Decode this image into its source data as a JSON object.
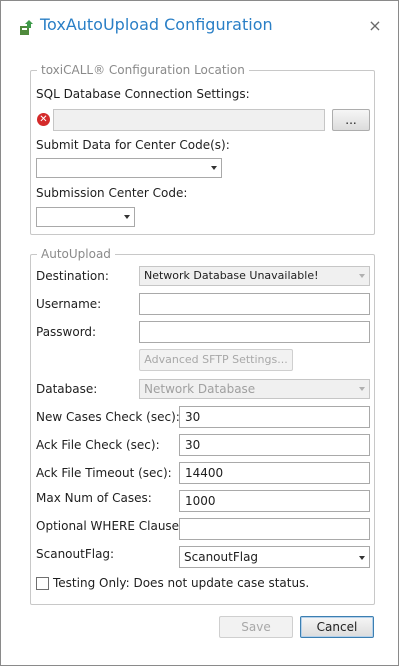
{
  "window": {
    "title": "ToxAutoUpload Configuration",
    "close_glyph": "×",
    "accent_color": "#2a7fc6"
  },
  "location_group": {
    "legend": "toxiCALL® Configuration Location",
    "sql_label": "SQL Database Connection Settings:",
    "sql_value": "",
    "browse_label": "...",
    "error_icon": "error-circle-icon",
    "submit_label": "Submit Data for Center Code(s):",
    "submit_value": "",
    "submission_label": "Submission Center Code:",
    "submission_value": ""
  },
  "autoupload_group": {
    "legend": "AutoUpload",
    "destination_label": "Destination:",
    "destination_value": "Network Database Unavailable!",
    "username_label": "Username:",
    "username_value": "",
    "password_label": "Password:",
    "password_value": "",
    "sftp_button": "Advanced SFTP Settings...",
    "database_label": "Database:",
    "database_value": "Network Database",
    "new_cases_label": "New Cases Check (sec):",
    "new_cases_value": "30",
    "ack_check_label": "Ack File Check (sec):",
    "ack_check_value": "30",
    "ack_timeout_label": "Ack File Timeout (sec):",
    "ack_timeout_value": "14400",
    "max_cases_label": "Max Num of Cases:",
    "max_cases_value": "1000",
    "where_label": "Optional WHERE Clause:",
    "where_value": "",
    "scanout_label": "ScanoutFlag:",
    "scanout_value": "ScanoutFlag",
    "testing_label": "Testing Only: Does not update case status."
  },
  "footer": {
    "save_label": "Save",
    "cancel_label": "Cancel"
  }
}
